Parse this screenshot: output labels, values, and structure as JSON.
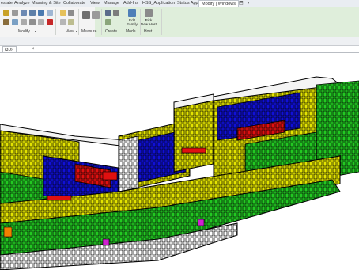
{
  "tabs": [
    {
      "label": "estate"
    },
    {
      "label": "Analyze"
    },
    {
      "label": "Massing & Site"
    },
    {
      "label": "Collaborate"
    },
    {
      "label": "View"
    },
    {
      "label": "Manage"
    },
    {
      "label": "Add-Ins"
    },
    {
      "label": "HSS_Application"
    },
    {
      "label": "Status App"
    },
    {
      "label": "Modify | Windows"
    }
  ],
  "ribbon": {
    "panels": [
      {
        "label": "Modify"
      },
      {
        "label": "View"
      },
      {
        "label": "Measure"
      },
      {
        "label": "Create"
      },
      {
        "label": "Mode"
      },
      {
        "label": "Host"
      }
    ],
    "edit_family": [
      "Edit",
      "Family"
    ],
    "pick_new_host": [
      "Pick",
      "New Host"
    ]
  },
  "view_tab": {
    "label": "{3D}",
    "close": "×"
  },
  "colors": {
    "ribbon_green": "#dfeedb",
    "yellow": "#e4e400",
    "green": "#22c922",
    "blue": "#1010d8",
    "red": "#e01010",
    "orange": "#f08000",
    "magenta": "#d020d0"
  }
}
